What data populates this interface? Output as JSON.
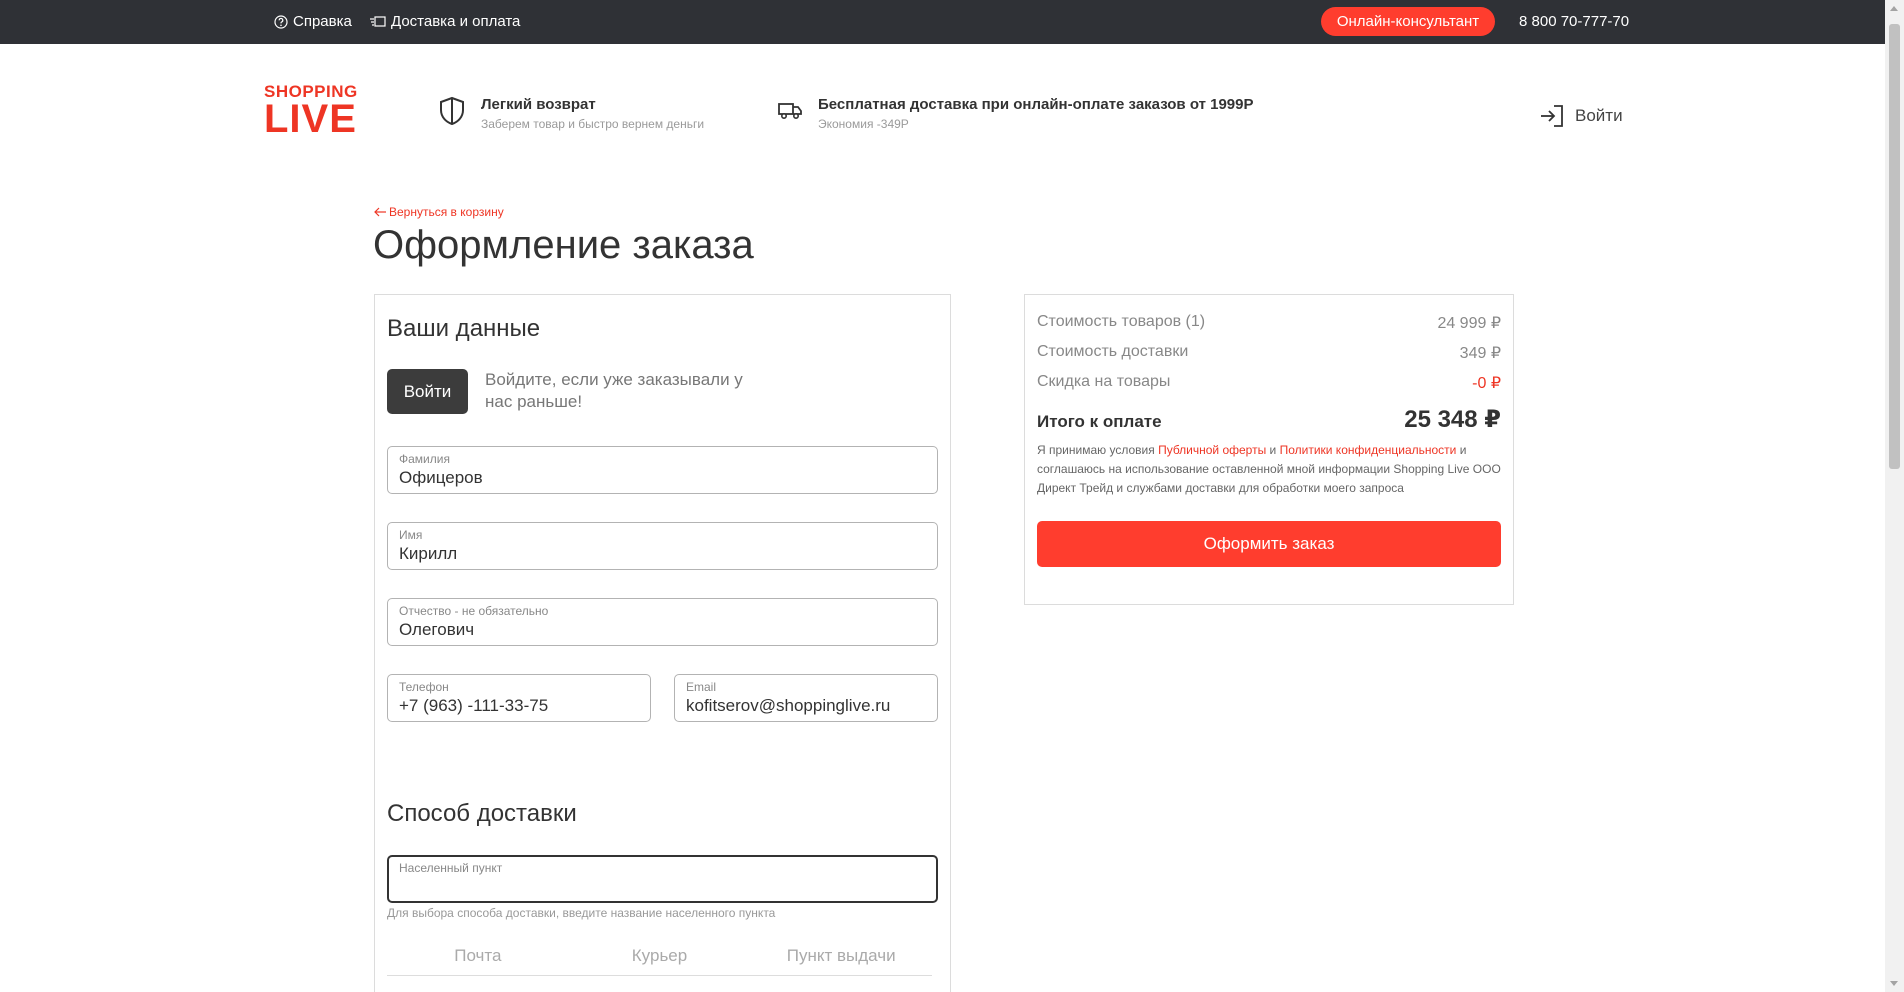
{
  "topbar": {
    "help_label": "Справка",
    "delivery_label": "Доставка и оплата",
    "consult_label": "Онлайн-консультант",
    "phone": "8 800 70-777-70"
  },
  "header": {
    "logo_line1": "SHOPPING",
    "logo_line2": "LIVE",
    "feature1_title": "Легкий возврат",
    "feature1_sub": "Заберем товар и быстро вернем деньги",
    "feature2_title": "Бесплатная доставка при онлайн-оплате заказов от 1999Р",
    "feature2_sub": "Экономия -349Р",
    "login_label": "Войти"
  },
  "page": {
    "back_label": "Вернуться в корзину",
    "title": "Оформление заказа"
  },
  "your_data": {
    "title": "Ваши данные",
    "login_button": "Войти",
    "login_hint": "Войдите, если уже заказывали у нас раньше!",
    "fields": [
      {
        "label": "Фамилия",
        "value": "Офицеров"
      },
      {
        "label": "Имя",
        "value": "Кирилл"
      },
      {
        "label": "Отчество - не обязательно",
        "value": "Олегович"
      },
      {
        "label": "Телефон",
        "value": "+7 (963) -111-33-75"
      },
      {
        "label": "Email",
        "value": "kofitserov@shoppinglive.ru"
      }
    ]
  },
  "delivery": {
    "title": "Способ доставки",
    "city_label": "Населенный пункт",
    "city_value": "",
    "hint": "Для выбора способа доставки, введите название населенного пункта",
    "tabs": [
      "Почта",
      "Курьер",
      "Пункт выдачи"
    ]
  },
  "summary": {
    "rows": [
      {
        "label": "Стоимость товаров (1)",
        "value": "24 999 ₽"
      },
      {
        "label": "Стоимость доставки",
        "value": "349 ₽"
      },
      {
        "label": "Скидка на товары",
        "value": "-0 ₽"
      }
    ],
    "total_label": "Итого к оплате",
    "total_value": "25 348 ₽",
    "terms_1": "Я принимаю условия ",
    "terms_link1": "Публичной оферты",
    "terms_2": " и ",
    "terms_link2": "Политики конфиденциальности",
    "terms_3": " и соглашаюсь на использование оставленной мной информации Shopping Live ООО Директ Трейд и службами доставки для обработки моего запроса",
    "order_button": "Оформить заказ"
  },
  "colors": {
    "accent": "#ff3d2e",
    "brand": "#ee3524",
    "topbar": "#2f3136",
    "dark_button": "#3c3c3c"
  }
}
